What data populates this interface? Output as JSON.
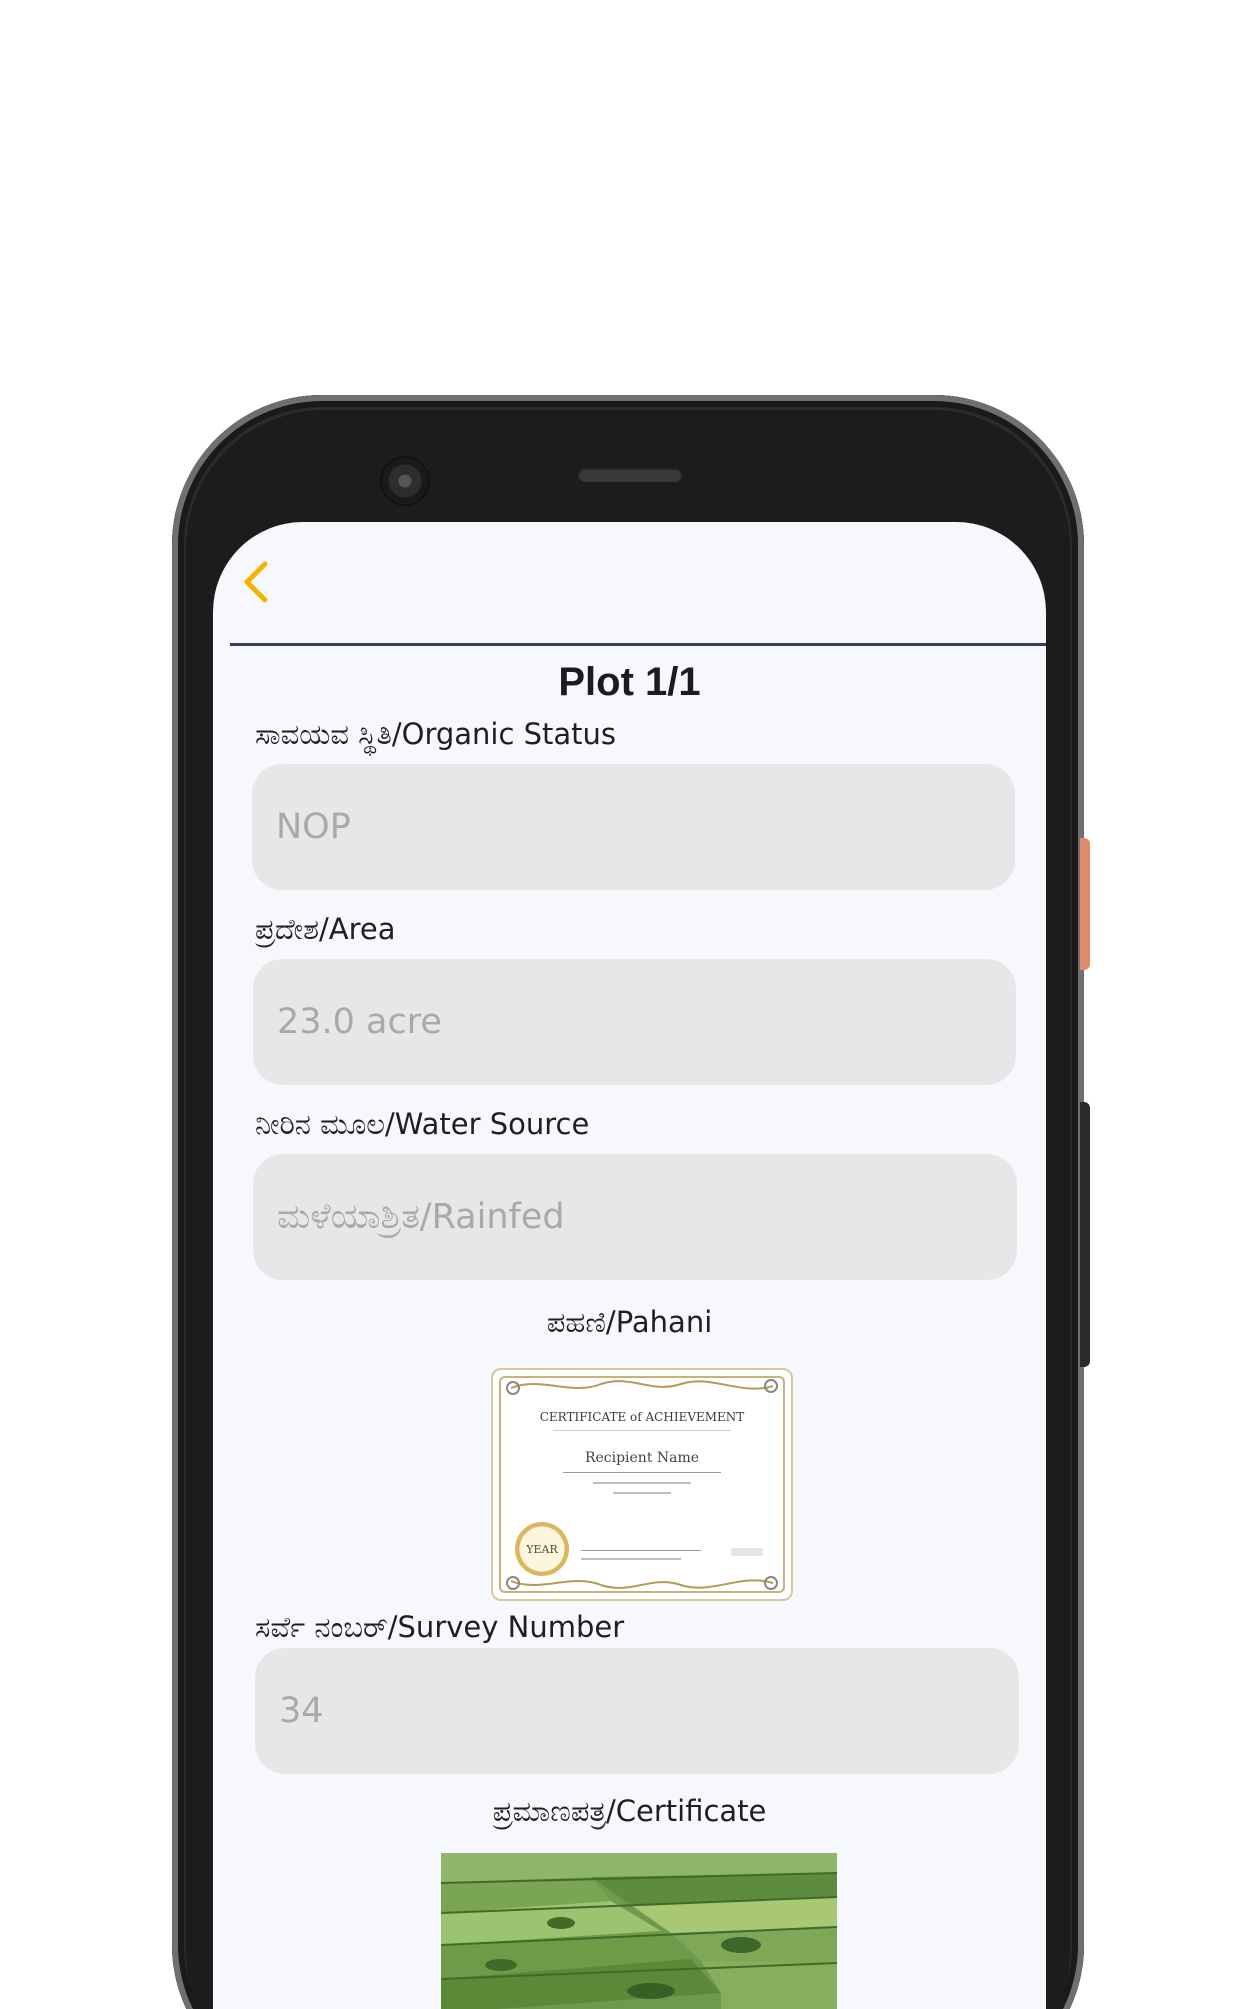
{
  "screen": {
    "title": "Plot 1/1",
    "fields": {
      "organic_status": {
        "label": "ಸಾವಯವ ಸ್ಥಿತಿ/Organic Status",
        "value": "NOP"
      },
      "area": {
        "label": "ಪ್ರದೇಶ/Area",
        "value": "23.0 acre"
      },
      "water_source": {
        "label": "ನೀರಿನ ಮೂಲ/Water Source",
        "value": "ಮಳೆಯಾಶ್ರಿತ/Rainfed"
      },
      "survey_number": {
        "label": "ಸರ್ವೆ ನಂಬರ್/Survey Number",
        "value": "34"
      }
    },
    "pahani": {
      "label": "ಪಹಣಿ/Pahani",
      "image_text": {
        "title": "CERTIFICATE of ACHIEVEMENT",
        "name": "Recipient Name",
        "seal": "YEAR"
      }
    },
    "certificate": {
      "label": "ಪ್ರಮಾಣಪತ್ರ/Certificate"
    }
  },
  "colors": {
    "accent": "#f5b400",
    "screen_bg": "#f7f8fd",
    "field_bg": "#e7e7e7",
    "field_text": "#a9a9a9",
    "divider": "#3b3b5c"
  },
  "icons": {
    "back": "chevron-left-icon"
  }
}
